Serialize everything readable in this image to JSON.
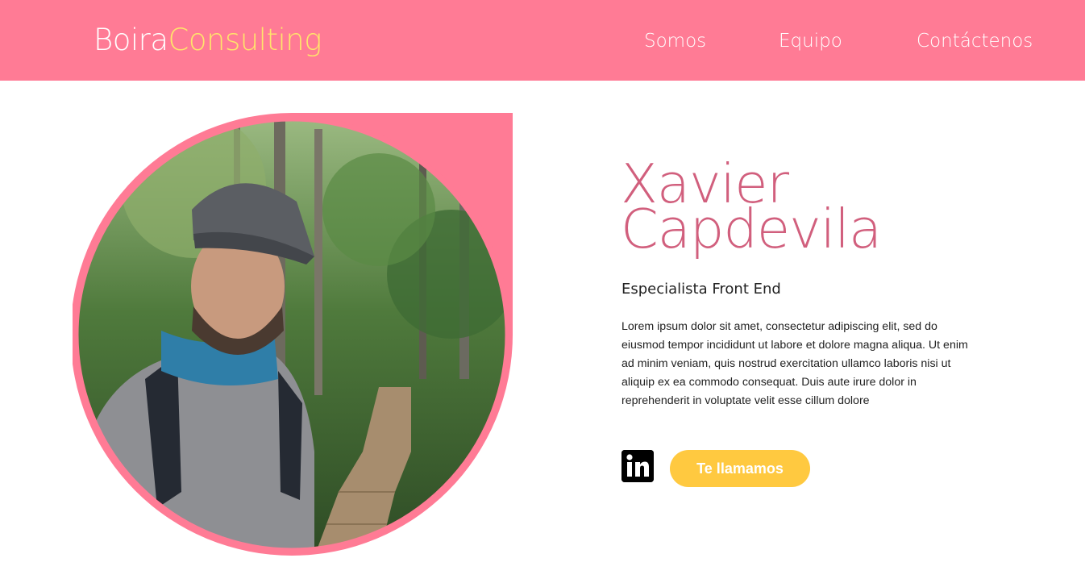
{
  "header": {
    "logo_part1": "Boira",
    "logo_part2": "Consulting",
    "nav": [
      {
        "label": "Somos"
      },
      {
        "label": "Equipo"
      },
      {
        "label": "Contáctenos"
      }
    ]
  },
  "profile": {
    "first_name": "Xavier",
    "last_name": "Capdevila",
    "role": "Especialista Front End",
    "bio": "Lorem ipsum dolor sit amet, consectetur adipiscing elit, sed do eiusmod tempor incididunt ut labore et dolore magna aliqua. Ut enim ad minim veniam, quis nostrud exercitation ullamco laboris nisi ut aliquip ex ea commodo consequat. Duis aute irure dolor in reprehenderit in voluptate velit esse cillum dolore",
    "linkedin_icon": "linkedin-icon",
    "cta_label": "Te llamamos"
  },
  "colors": {
    "brand_pink": "#ff7b95",
    "name_pink": "#d15f7d",
    "logo_yellow": "#ffe56b",
    "cta_yellow": "#ffc940"
  }
}
